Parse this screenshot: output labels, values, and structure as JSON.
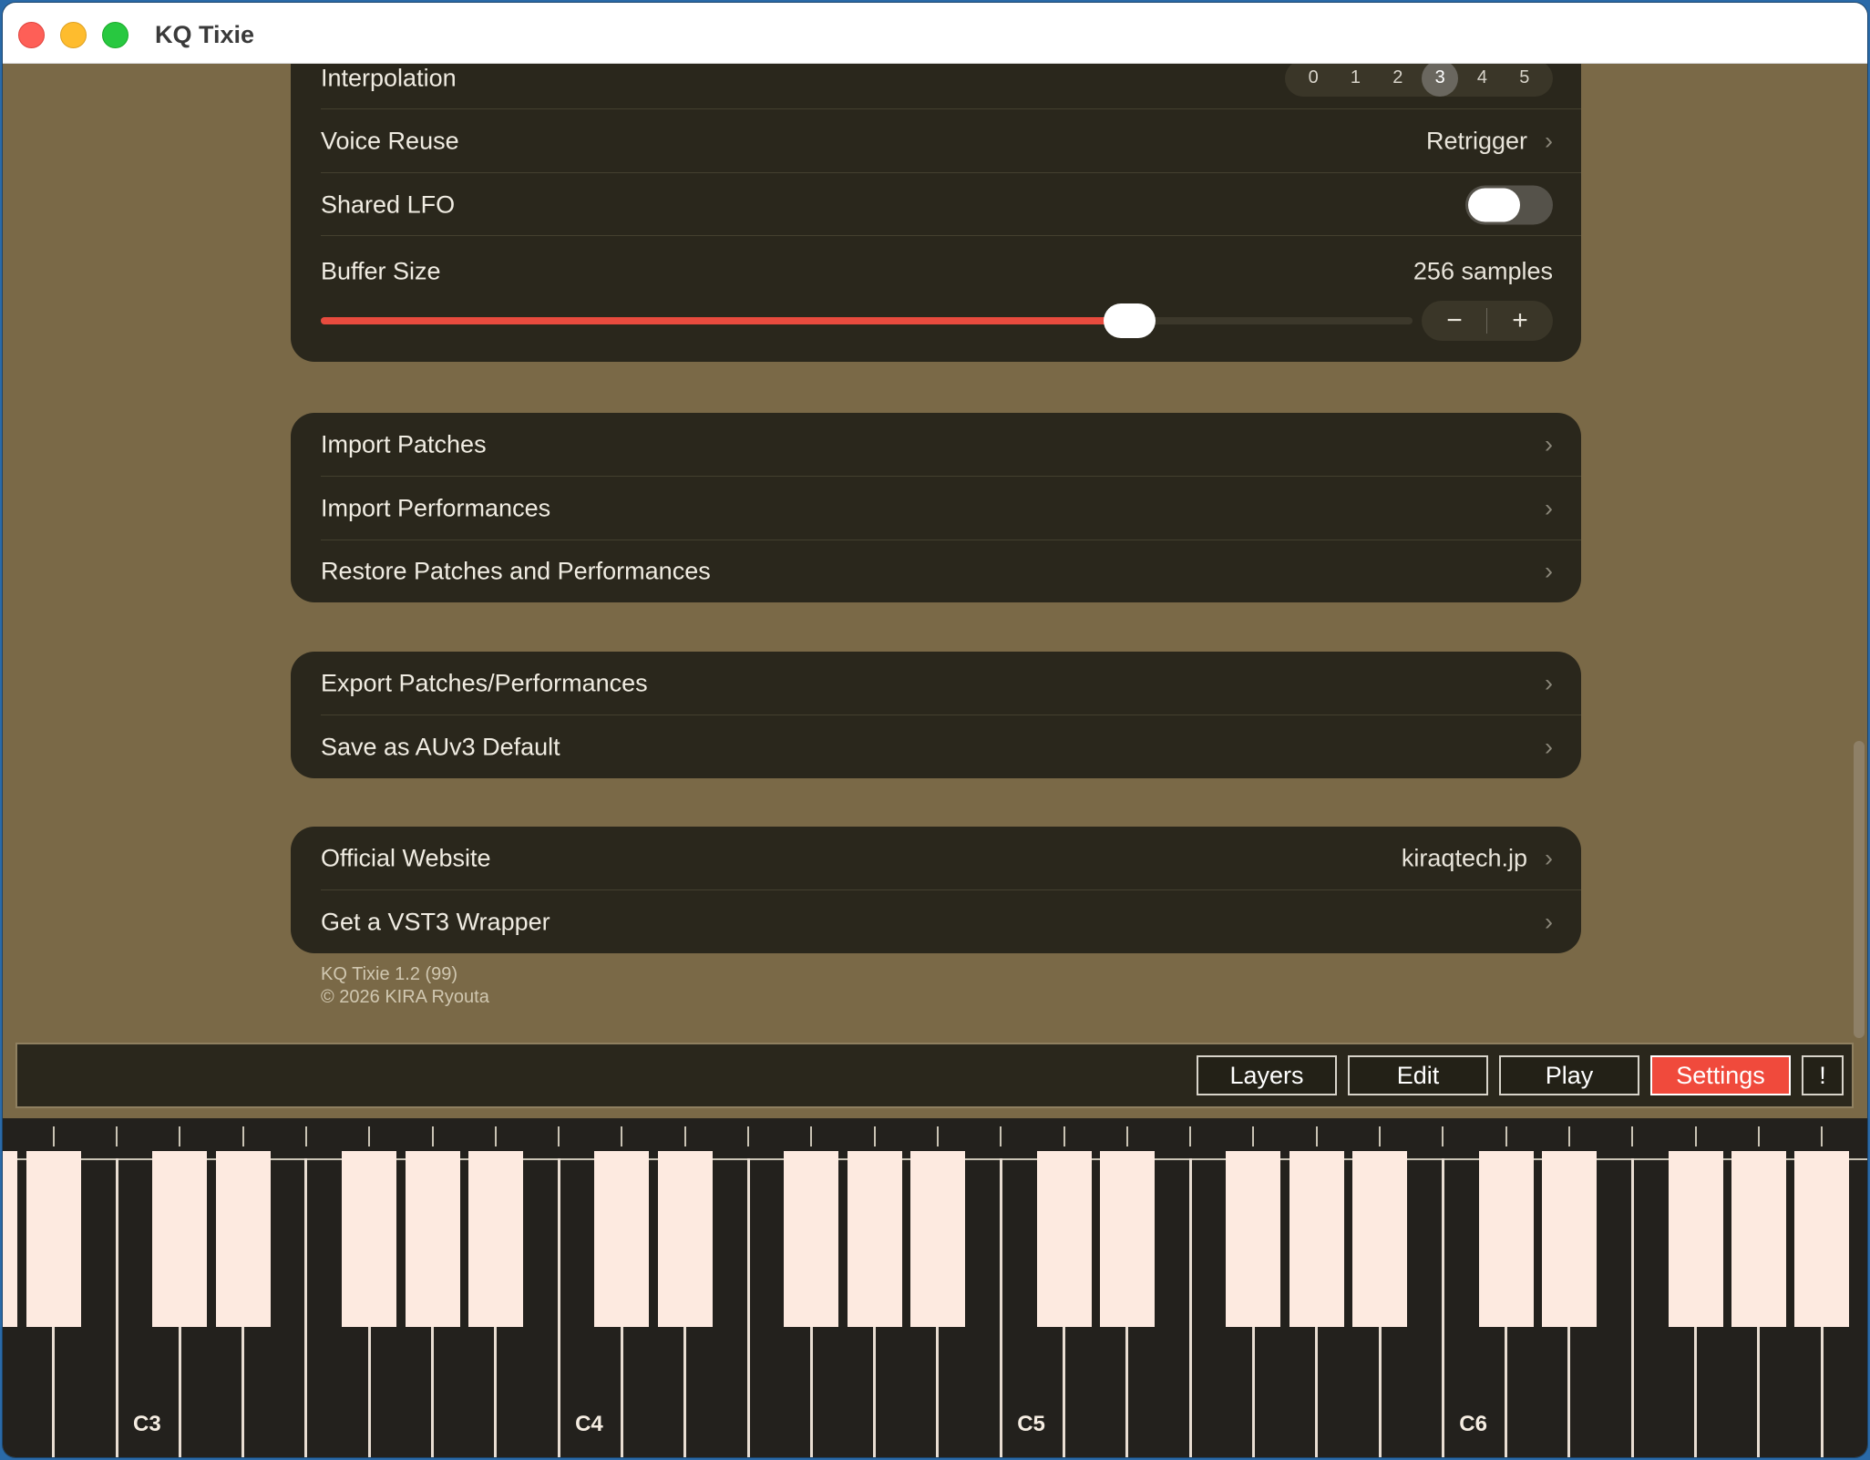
{
  "window": {
    "title": "KQ Tixie"
  },
  "audio_settings": {
    "interpolation": {
      "label": "Interpolation",
      "options": [
        "0",
        "1",
        "2",
        "3",
        "4",
        "5"
      ],
      "selected": "3"
    },
    "voice_reuse": {
      "label": "Voice Reuse",
      "value": "Retrigger"
    },
    "shared_lfo": {
      "label": "Shared LFO",
      "enabled": false
    },
    "buffer_size": {
      "label": "Buffer Size",
      "value": "256 samples",
      "slider_fraction": 0.74,
      "decrement": "−",
      "increment": "+"
    }
  },
  "import_group": {
    "items": [
      {
        "label": "Import Patches"
      },
      {
        "label": "Import Performances"
      },
      {
        "label": "Restore Patches and Performances"
      }
    ]
  },
  "export_group": {
    "items": [
      {
        "label": "Export Patches/Performances"
      },
      {
        "label": "Save as AUv3 Default"
      }
    ]
  },
  "links_group": {
    "website": {
      "label": "Official Website",
      "value": "kiraqtech.jp"
    },
    "vst3": {
      "label": "Get a VST3 Wrapper"
    }
  },
  "footer": {
    "version": "KQ Tixie 1.2 (99)",
    "copyright": "© 2026 KIRA Ryouta"
  },
  "toolbar": {
    "layers": "Layers",
    "edit": "Edit",
    "play": "Play",
    "settings": "Settings",
    "alert": "!",
    "active": "Settings"
  },
  "keyboard": {
    "octave_labels": [
      "C3",
      "C4",
      "C5",
      "C6"
    ]
  },
  "colors": {
    "accent": "#e84b3e",
    "background": "#7a6947",
    "panel": "#2a271c",
    "key": "#fdeae0"
  }
}
